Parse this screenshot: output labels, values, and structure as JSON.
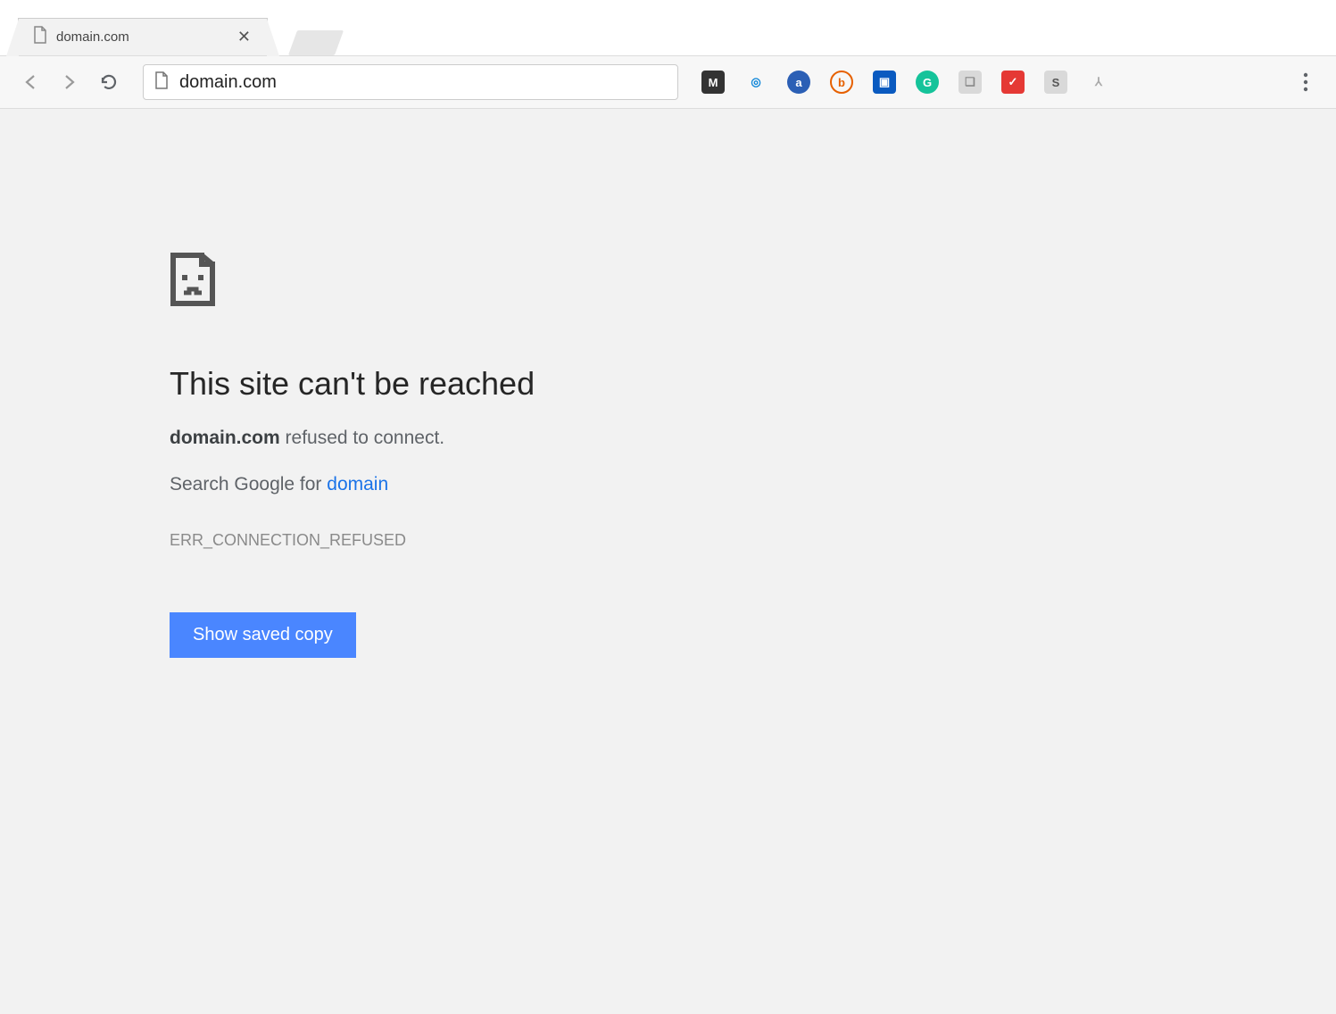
{
  "tab": {
    "title": "domain.com"
  },
  "toolbar": {
    "url": "domain.com"
  },
  "extensions": [
    {
      "name": "megaupload-icon",
      "letter": "M",
      "bg": "#333333",
      "fg": "#ffffff"
    },
    {
      "name": "quicksearch-icon",
      "letter": "◎",
      "bg": "transparent",
      "fg": "#0a84d8"
    },
    {
      "name": "amazon-assistant-icon",
      "letter": "a",
      "bg": "#2b5fb5",
      "fg": "#ffffff",
      "round": true
    },
    {
      "name": "bitly-icon",
      "letter": "b",
      "bg": "transparent",
      "fg": "#e66000",
      "round": true,
      "ring": "#e66000"
    },
    {
      "name": "screenshot-icon",
      "letter": "▣",
      "bg": "#0a5ac0",
      "fg": "#ffffff"
    },
    {
      "name": "grammarly-icon",
      "letter": "G",
      "bg": "#15c39a",
      "fg": "#ffffff",
      "round": true
    },
    {
      "name": "clipboard-icon",
      "letter": "❏",
      "bg": "#d9d9d9",
      "fg": "#888888"
    },
    {
      "name": "todo-extension-icon",
      "letter": "✓",
      "bg": "#e53935",
      "fg": "#ffffff"
    },
    {
      "name": "siteblock-icon",
      "letter": "S",
      "bg": "#d9d9d9",
      "fg": "#555555"
    },
    {
      "name": "compass-icon",
      "letter": "⅄",
      "bg": "transparent",
      "fg": "#aaaaaa"
    }
  ],
  "error": {
    "title": "This site can't be reached",
    "domain": "domain.com",
    "refused_text": " refused to connect.",
    "search_prefix": "Search Google for ",
    "search_term": "domain",
    "code": "ERR_CONNECTION_REFUSED",
    "button_label": "Show saved copy"
  }
}
